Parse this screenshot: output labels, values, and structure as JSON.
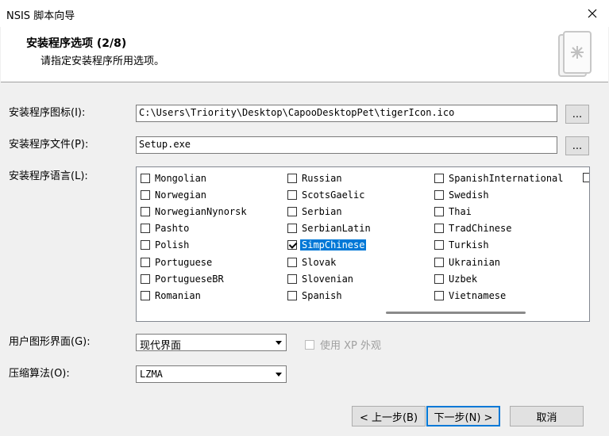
{
  "window": {
    "title": "NSIS 脚本向导"
  },
  "header": {
    "title": "安装程序选项 (2/8)",
    "subtitle": "请指定安装程序所用选项。"
  },
  "icon_field": {
    "label": "安装程序图标(I):",
    "value": "C:\\Users\\Triority\\Desktop\\CapooDesktopPet\\tigerIcon.ico",
    "browse": "..."
  },
  "file_field": {
    "label": "安装程序文件(P):",
    "value": "Setup.exe",
    "browse": "..."
  },
  "languages": {
    "label": "安装程序语言(L):",
    "col1": [
      {
        "name": "Mongolian",
        "checked": false
      },
      {
        "name": "Norwegian",
        "checked": false
      },
      {
        "name": "NorwegianNynorsk",
        "checked": false
      },
      {
        "name": "Pashto",
        "checked": false
      },
      {
        "name": "Polish",
        "checked": false
      },
      {
        "name": "Portuguese",
        "checked": false
      },
      {
        "name": "PortugueseBR",
        "checked": false
      },
      {
        "name": "Romanian",
        "checked": false
      }
    ],
    "col2": [
      {
        "name": "Russian",
        "checked": false
      },
      {
        "name": "ScotsGaelic",
        "checked": false
      },
      {
        "name": "Serbian",
        "checked": false
      },
      {
        "name": "SerbianLatin",
        "checked": false
      },
      {
        "name": "SimpChinese",
        "checked": true
      },
      {
        "name": "Slovak",
        "checked": false
      },
      {
        "name": "Slovenian",
        "checked": false
      },
      {
        "name": "Spanish",
        "checked": false
      }
    ],
    "col3": [
      {
        "name": "SpanishInternational",
        "checked": false
      },
      {
        "name": "Swedish",
        "checked": false
      },
      {
        "name": "Thai",
        "checked": false
      },
      {
        "name": "TradChinese",
        "checked": false
      },
      {
        "name": "Turkish",
        "checked": false
      },
      {
        "name": "Ukrainian",
        "checked": false
      },
      {
        "name": "Uzbek",
        "checked": false
      },
      {
        "name": "Vietnamese",
        "checked": false
      }
    ]
  },
  "gui": {
    "label": "用户图形界面(G):",
    "value": "现代界面",
    "xp_label": "使用 XP 外观"
  },
  "compression": {
    "label": "压缩算法(O):",
    "value": "LZMA"
  },
  "buttons": {
    "back": "< 上一步(B)",
    "next": "下一步(N) >",
    "cancel": "取消"
  }
}
